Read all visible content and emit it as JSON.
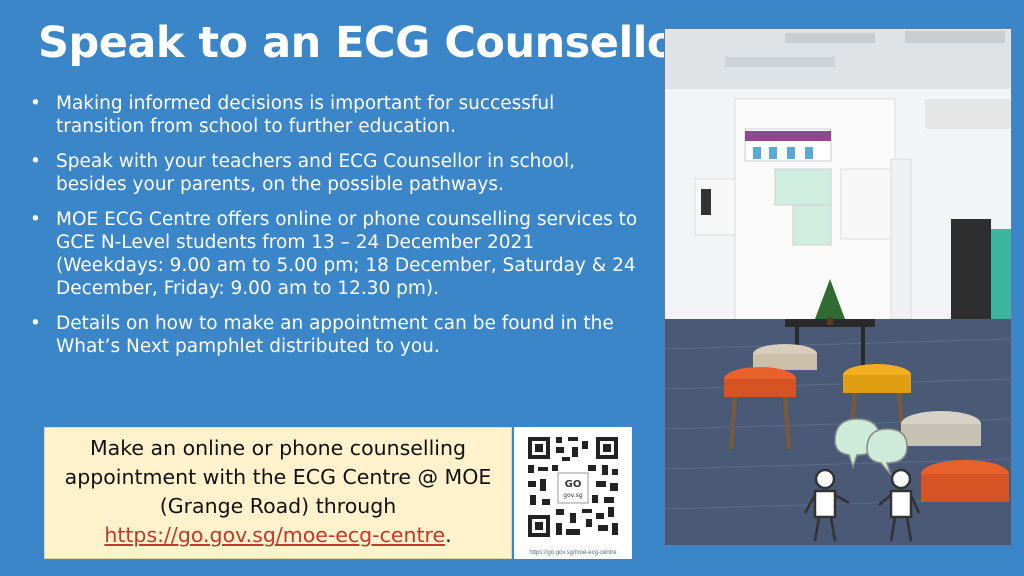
{
  "title": "Speak to an ECG Counsellor",
  "bullets": [
    "Making informed decisions is important for successful transition from school to further education.",
    "Speak with your teachers and ECG Counsellor in school, besides your parents, on the possible pathways.",
    "MOE ECG Centre offers online or phone counselling services to GCE N-Level students from 13 – 24 December 2021 (Weekdays: 9.00 am to 5.00 pm; 18 December, Saturday & 24 December, Friday: 9.00 am to 12.30 pm).",
    "Details on how to make an appointment can be found in the What’s Next pamphlet distributed to you."
  ],
  "bullet_glyph": "•",
  "callout": {
    "line1": "Make an online or phone counselling",
    "line2": "appointment with the ECG Centre @ MOE",
    "line3": "(Grange Road) through",
    "link": "https://go.gov.sg/moe-ecg-centre",
    "link_suffix": "."
  },
  "qr": {
    "logo_text": "GO",
    "logo_sub": "gov.sg",
    "caption": "https://go.gov.sg/moe-ecg-centre"
  },
  "colors": {
    "background": "#3a86c8",
    "callout_bg": "#fff2cc",
    "link": "#c0392b"
  }
}
